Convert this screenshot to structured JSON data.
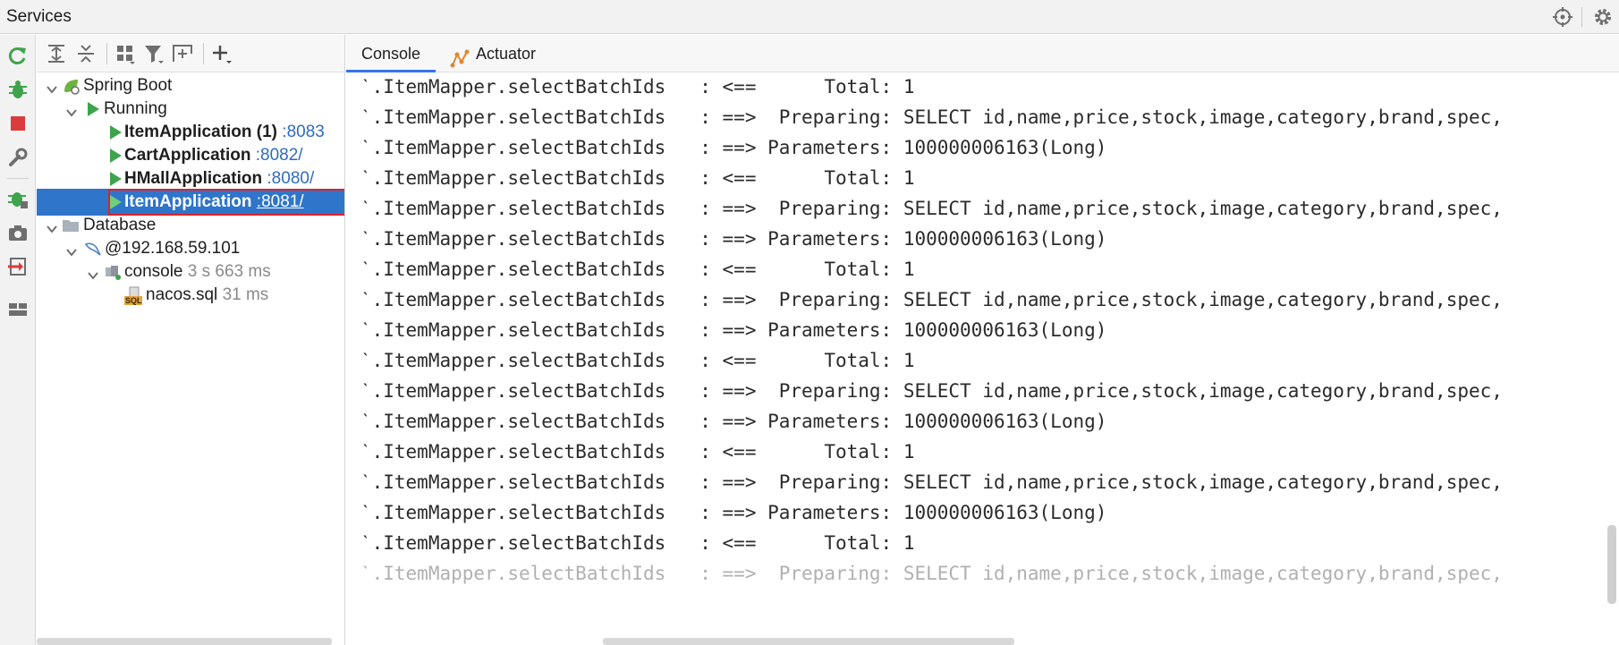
{
  "titlebar": {
    "title": "Services"
  },
  "tabs": [
    {
      "label": "Console"
    },
    {
      "label": "Actuator"
    }
  ],
  "tree": {
    "spring_boot": {
      "label": "Spring Boot"
    },
    "running": {
      "label": "Running"
    },
    "apps": [
      {
        "name": "ItemApplication (1)",
        "port": ":8083"
      },
      {
        "name": "CartApplication",
        "port": ":8082/"
      },
      {
        "name": "HMallApplication",
        "port": ":8080/"
      },
      {
        "name": "ItemApplication",
        "port": ":8081/"
      }
    ],
    "database": {
      "label": "Database"
    },
    "host": {
      "label": "@192.168.59.101"
    },
    "console": {
      "label": "console",
      "time": "3 s 663 ms"
    },
    "sql": {
      "label": "nacos.sql",
      "time": "31 ms"
    },
    "sql_badge": "SQL"
  },
  "console_lines": [
    "ˋ.ItemMapper.selectBatchIds   : <==      Total: 1",
    "ˋ.ItemMapper.selectBatchIds   : ==>  Preparing: SELECT id,name,price,stock,image,category,brand,spec,",
    "ˋ.ItemMapper.selectBatchIds   : ==> Parameters: 100000006163(Long)",
    "ˋ.ItemMapper.selectBatchIds   : <==      Total: 1",
    "ˋ.ItemMapper.selectBatchIds   : ==>  Preparing: SELECT id,name,price,stock,image,category,brand,spec,",
    "ˋ.ItemMapper.selectBatchIds   : ==> Parameters: 100000006163(Long)",
    "ˋ.ItemMapper.selectBatchIds   : <==      Total: 1",
    "ˋ.ItemMapper.selectBatchIds   : ==>  Preparing: SELECT id,name,price,stock,image,category,brand,spec,",
    "ˋ.ItemMapper.selectBatchIds   : ==> Parameters: 100000006163(Long)",
    "ˋ.ItemMapper.selectBatchIds   : <==      Total: 1",
    "ˋ.ItemMapper.selectBatchIds   : ==>  Preparing: SELECT id,name,price,stock,image,category,brand,spec,",
    "ˋ.ItemMapper.selectBatchIds   : ==> Parameters: 100000006163(Long)",
    "ˋ.ItemMapper.selectBatchIds   : <==      Total: 1",
    "ˋ.ItemMapper.selectBatchIds   : ==>  Preparing: SELECT id,name,price,stock,image,category,brand,spec,",
    "ˋ.ItemMapper.selectBatchIds   : ==> Parameters: 100000006163(Long)",
    "ˋ.ItemMapper.selectBatchIds   : <==      Total: 1",
    "ˋ.ItemMapper.selectBatchIds   : ==>  Preparing: SELECT id,name,price,stock,image,category,brand,spec,"
  ],
  "colors": {
    "selection": "#2f75c9",
    "highlight_border": "#d9252b",
    "run_green": "#3fa34d",
    "port_blue": "#2e6bc0"
  },
  "icons": {
    "left_toolbar": [
      "rerun-icon",
      "debug-icon",
      "stop-icon",
      "settings-wrench-icon",
      "debug-attach-icon",
      "camera-icon",
      "exit-icon",
      "layout-icon"
    ],
    "tree_toolbar": [
      "expand-all-icon",
      "collapse-all-icon",
      "group-by-icon",
      "filter-icon",
      "new-group-icon",
      "add-service-icon"
    ],
    "title_actions": [
      "crosshair-icon",
      "gear-icon"
    ]
  }
}
